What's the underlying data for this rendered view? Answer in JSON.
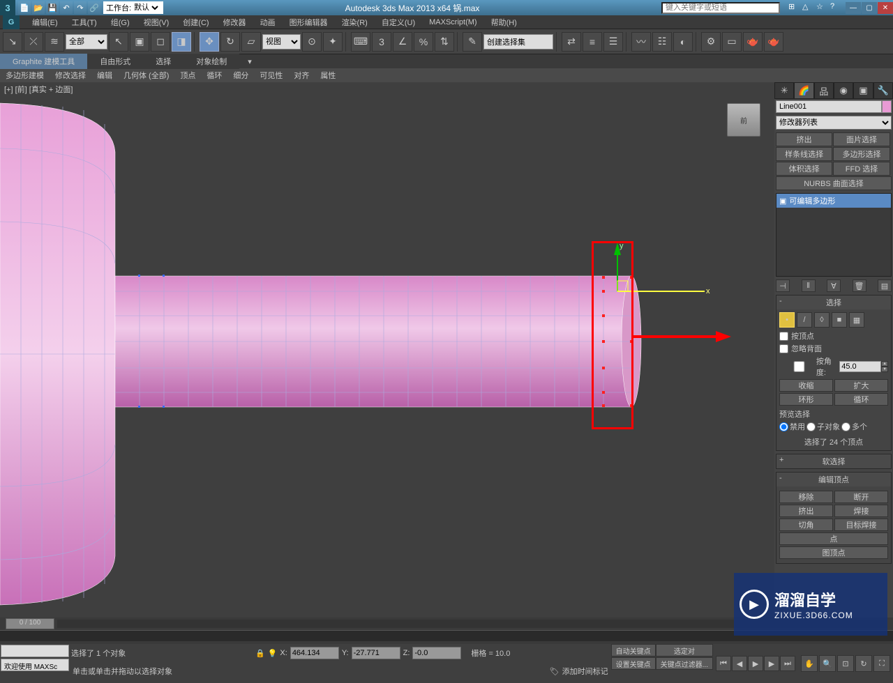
{
  "title": "Autodesk 3ds Max  2013 x64     锅.max",
  "workspace_label": "工作台:",
  "workspace_value": "默认",
  "search_placeholder": "键入关键字或短语",
  "menu": [
    "编辑(E)",
    "工具(T)",
    "组(G)",
    "视图(V)",
    "创建(C)",
    "修改器",
    "动画",
    "图形编辑器",
    "渲染(R)",
    "自定义(U)",
    "MAXScript(M)",
    "帮助(H)"
  ],
  "toolbar_select_all": "全部",
  "toolbar_ref": "视图",
  "toolbar_named_set": "创建选择集",
  "ribbon_tabs": [
    "Graphite 建模工具",
    "自由形式",
    "选择",
    "对象绘制"
  ],
  "ribbon_sub": [
    "多边形建模",
    "修改选择",
    "编辑",
    "几何体 (全部)",
    "顶点",
    "循环",
    "细分",
    "可见性",
    "对齐",
    "属性"
  ],
  "viewport_label": "[+] [前] [真实 + 边面]",
  "viewcube": "前",
  "object_name": "Line001",
  "modifier_list": "修改器列表",
  "mod_buttons": [
    "挤出",
    "面片选择",
    "样条线选择",
    "多边形选择",
    "体积选择",
    "FFD 选择"
  ],
  "mod_nurbs": "NURBS 曲面选择",
  "stack_item": "可编辑多边形",
  "rollout_selection": "选择",
  "chk_by_vertex": "按顶点",
  "chk_ignore_backfacing": "忽略背面",
  "chk_by_angle": "按角度:",
  "angle_value": "45.0",
  "btn_shrink": "收缩",
  "btn_grow": "扩大",
  "btn_ring": "环形",
  "btn_loop": "循环",
  "preview_sel": "预览选择",
  "radio_disabled": "禁用",
  "radio_subobj": "子对象",
  "radio_multi": "多个",
  "sel_status": "选择了 24 个顶点",
  "rollout_softsel": "软选择",
  "rollout_editvert": "编辑顶点",
  "btn_remove": "移除",
  "btn_break": "断开",
  "btn_extrude": "挤出",
  "btn_weld": "焊接",
  "btn_chamfer": "切角",
  "btn_target_weld": "目标焊接",
  "time_slider": "0 / 100",
  "status_welcome": "欢迎使用  MAXSc",
  "status_sel": "选择了 1 个对象",
  "status_prompt": "单击或单击并拖动以选择对象",
  "coord_x": "464.134",
  "coord_y": "-27.771",
  "coord_z": "-0.0",
  "grid": "栅格 = 10.0",
  "add_time_tag": "添加时间标记",
  "auto_key": "自动关键点",
  "set_key": "设置关键点",
  "selected_obj": "选定对",
  "key_filters": "关键点过滤器...",
  "watermark_cn": "溜溜自学",
  "watermark_en": "ZIXUE.3D66.COM",
  "rollout_edit_vertex_extra1": "点",
  "rollout_edit_vertex_extra2": "图顶点"
}
